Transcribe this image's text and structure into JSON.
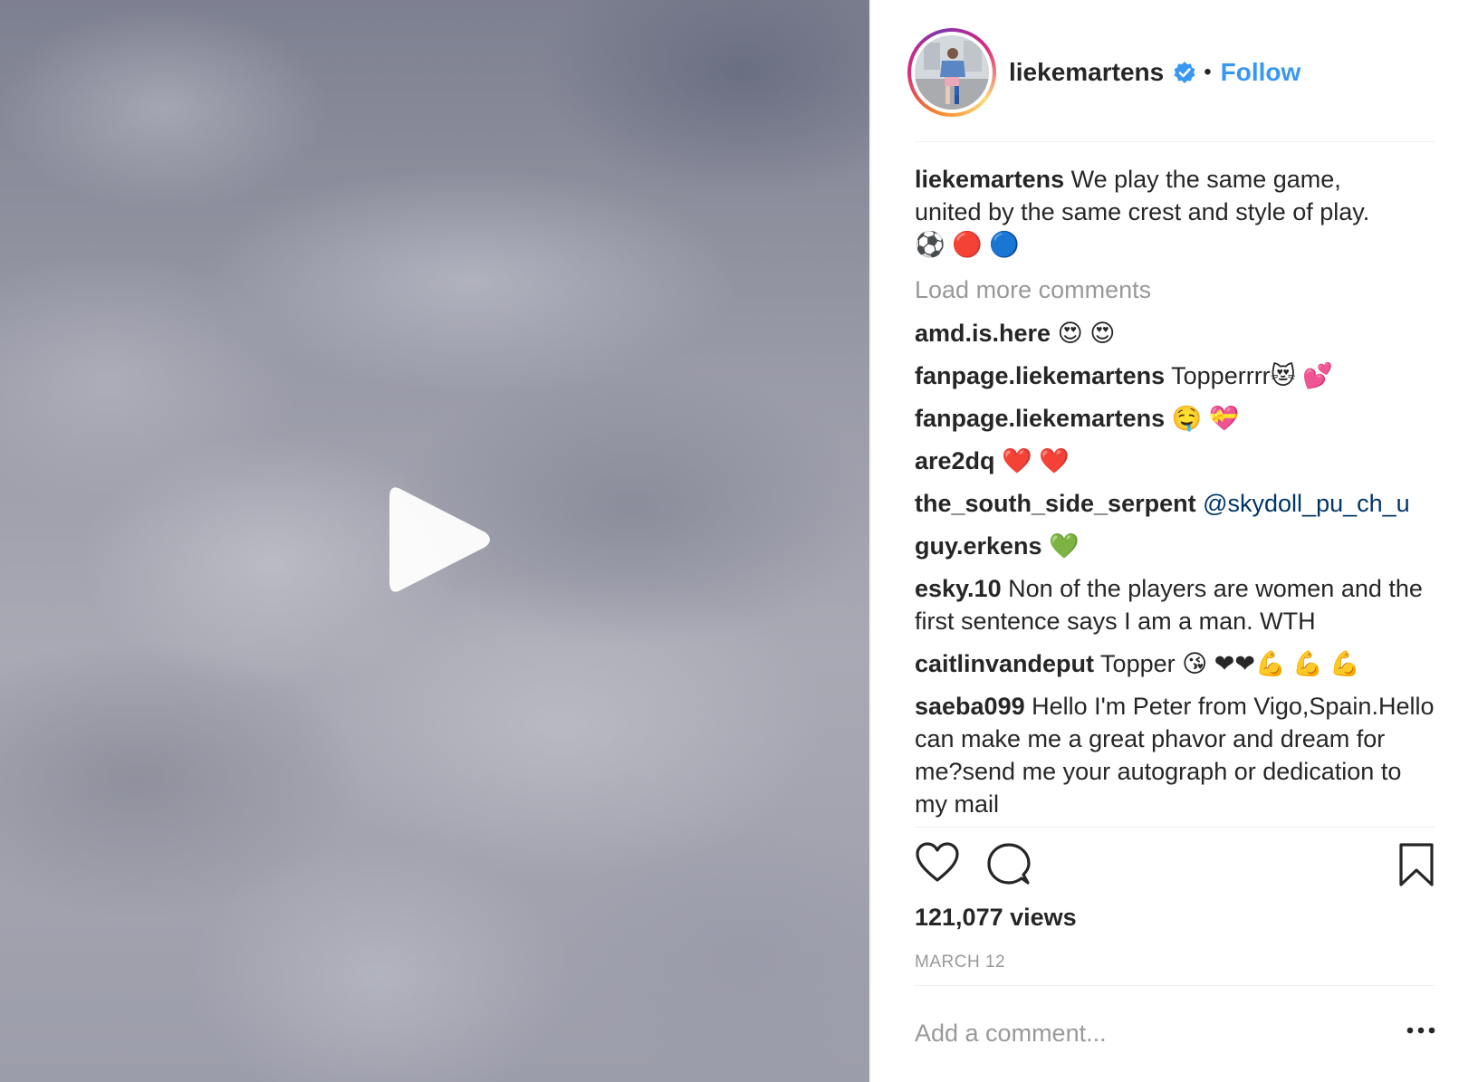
{
  "post": {
    "username": "liekemartens",
    "separator": "•",
    "follow_label": "Follow"
  },
  "caption": {
    "username": "liekemartens",
    "text_line1": "We play the same game,",
    "text_line2": "united by the same crest and style of play.",
    "emoji": "⚽ 🔴 🔵"
  },
  "load_more_label": "Load more comments",
  "comments": [
    {
      "username": "amd.is.here",
      "text": "😍 😍"
    },
    {
      "username": "fanpage.liekemartens",
      "text": "Topperrrr😻 💕"
    },
    {
      "username": "fanpage.liekemartens",
      "text": "🤤 💝"
    },
    {
      "username": "are2dq",
      "text": "❤️ ❤️"
    },
    {
      "username": "the_south_side_serpent",
      "mention": "@skydoll_pu_ch_u"
    },
    {
      "username": "guy.erkens",
      "text": "💚"
    },
    {
      "username": "esky.10",
      "text": "Non of the players are women and the first sentence says I am a man. WTH"
    },
    {
      "username": "caitlinvandeput",
      "text": "Topper 😘 ❤❤💪 💪 💪"
    },
    {
      "username": "saeba099",
      "text": "Hello I'm Peter from Vigo,Spain.Hello can make me a great phavor and dream for me?send me your autograph or dedication to my mail"
    }
  ],
  "stats": {
    "views": "121,077 views",
    "date": "MARCH 12"
  },
  "add_comment": {
    "placeholder": "Add a comment..."
  },
  "colors": {
    "follow": "#3897f0",
    "verified": "#3897f0",
    "mention": "#003569",
    "muted": "#999999",
    "text": "#262626"
  },
  "icons": {
    "play": "play-icon",
    "verified": "verified-badge-icon",
    "like": "heart-icon",
    "comment": "comment-bubble-icon",
    "save": "bookmark-icon",
    "more": "more-options-icon"
  }
}
